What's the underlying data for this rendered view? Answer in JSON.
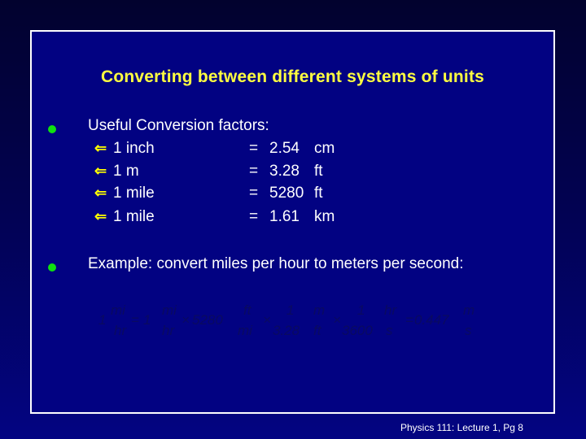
{
  "slide": {
    "title": "Converting between different systems of units",
    "bullets": [
      {
        "text": "Useful Conversion factors:"
      },
      {
        "text": "Example:  convert miles per hour to meters per second:"
      }
    ],
    "factors": [
      {
        "lhs": "1 inch",
        "eq": "=",
        "value": "2.54",
        "unit": "cm"
      },
      {
        "lhs": "1 m",
        "eq": "=",
        "value": "3.28",
        "unit": "ft"
      },
      {
        "lhs": "1 mile",
        "eq": "=",
        "value": "5280",
        "unit": "ft"
      },
      {
        "lhs": "1 mile",
        "eq": "=",
        "value": "1.61",
        "unit": "km"
      }
    ],
    "arrow_icon": "⇐",
    "equation": {
      "t1": "1",
      "f1n": "mi",
      "f1d": "hr",
      "eq1": "=",
      "t2": "1",
      "f2n": "mi",
      "f2d": "hr",
      "x1": "×",
      "t3": "5280",
      "f3n": "ft",
      "f3d": "mi",
      "x2": "×",
      "f4n": "1",
      "f4d": "3.28",
      "f5n": "m",
      "f5d": "ft",
      "x3": "×",
      "f6n": "1",
      "f6d": "3600",
      "f7n": "hr",
      "f7d": "s",
      "eq2": "=",
      "result": "0.447",
      "f8n": "m",
      "f8d": "s"
    },
    "footer": "Physics 111: Lecture 1, Pg 8"
  },
  "colors": {
    "title": "#ffff40",
    "bullet": "#10e010",
    "frame_bg": "#020282"
  }
}
